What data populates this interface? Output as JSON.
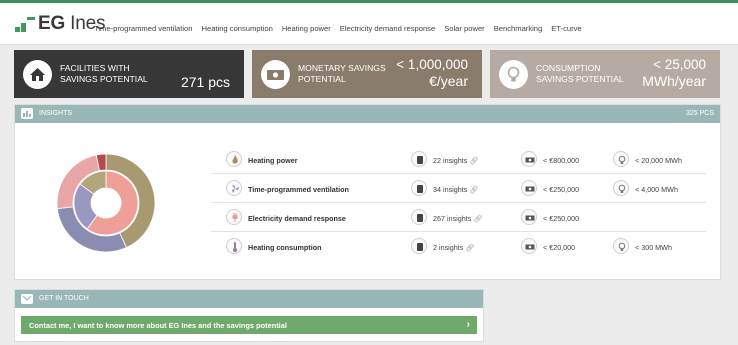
{
  "app": {
    "brand_bold": "EG",
    "brand_rest": "Ines"
  },
  "nav": {
    "items": [
      "Time-programmed ventilation",
      "Heating consumption",
      "Heating power",
      "Electricity demand response",
      "Solar power",
      "Benchmarking",
      "ET-curve"
    ]
  },
  "tiles": [
    {
      "label_line1": "FACILITIES WITH",
      "label_line2": "SAVINGS POTENTIAL",
      "value": "271 pcs",
      "unit": "",
      "icon": "house-icon",
      "color": "#373737"
    },
    {
      "label_line1": "MONETARY SAVINGS",
      "label_line2": "POTENTIAL",
      "value": "< 1,000,000",
      "unit": "€/year",
      "icon": "banknote-icon",
      "color": "#8a7c6b"
    },
    {
      "label_line1": "CONSUMPTION",
      "label_line2": "SAVINGS POTENTIAL",
      "value": "< 25,000",
      "unit": "MWh/year",
      "icon": "lightbulb-icon",
      "color": "#b5aba2"
    }
  ],
  "insights": {
    "title": "INSIGHTS",
    "count": "325 PCS",
    "rows": [
      {
        "name": "Heating power",
        "insights": "22 insights",
        "money": "< €800,000",
        "energy": "< 20,000 MWh",
        "icon": "flame-icon"
      },
      {
        "name": "Time-programmed ventilation",
        "insights": "34 insights",
        "money": "< €250,000",
        "energy": "< 4,000 MWh",
        "icon": "fan-icon"
      },
      {
        "name": "Electricity demand response",
        "insights": "267 insights",
        "money": "< €250,000",
        "energy": "",
        "icon": "plug-icon"
      },
      {
        "name": "Heating consumption",
        "insights": "2 insights",
        "money": "< €20,000",
        "energy": "< 300 MWh",
        "icon": "thermometer-icon"
      }
    ]
  },
  "chart_data": {
    "type": "pie",
    "outer": {
      "values": [
        82,
        57,
        45,
        6
      ],
      "colors": [
        "#a89a70",
        "#8a8cb2",
        "#e9a6a6",
        "#b5494f"
      ]
    },
    "inner": {
      "values": [
        60,
        25,
        15
      ],
      "colors": [
        "#ee9f98",
        "#9a97c0",
        "#b3a57c"
      ]
    }
  },
  "contact": {
    "title": "GET IN TOUCH",
    "button_label": "Contact me, I want to know more about EG Ines and the savings potential",
    "chevron": "›"
  }
}
